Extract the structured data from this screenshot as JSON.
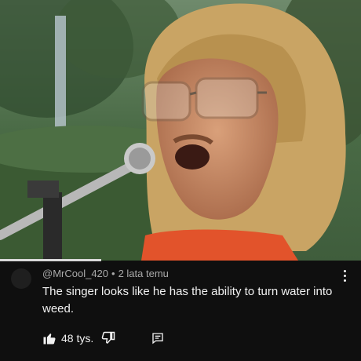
{
  "comment": {
    "author": "@MrCool_420",
    "separator": "•",
    "time": "2 lata temu",
    "text": "The singer looks like he has the ability to turn water into weed.",
    "likes": "48 tys.",
    "progress_fraction": 0.28
  },
  "icons": {
    "menu": "more-vert-icon",
    "like": "thumbs-up-icon",
    "dislike": "thumbs-down-icon",
    "reply": "reply-icon"
  },
  "colors": {
    "background": "#0f0f0f",
    "text": "#f1f1f1",
    "meta": "#aaaaaa"
  }
}
